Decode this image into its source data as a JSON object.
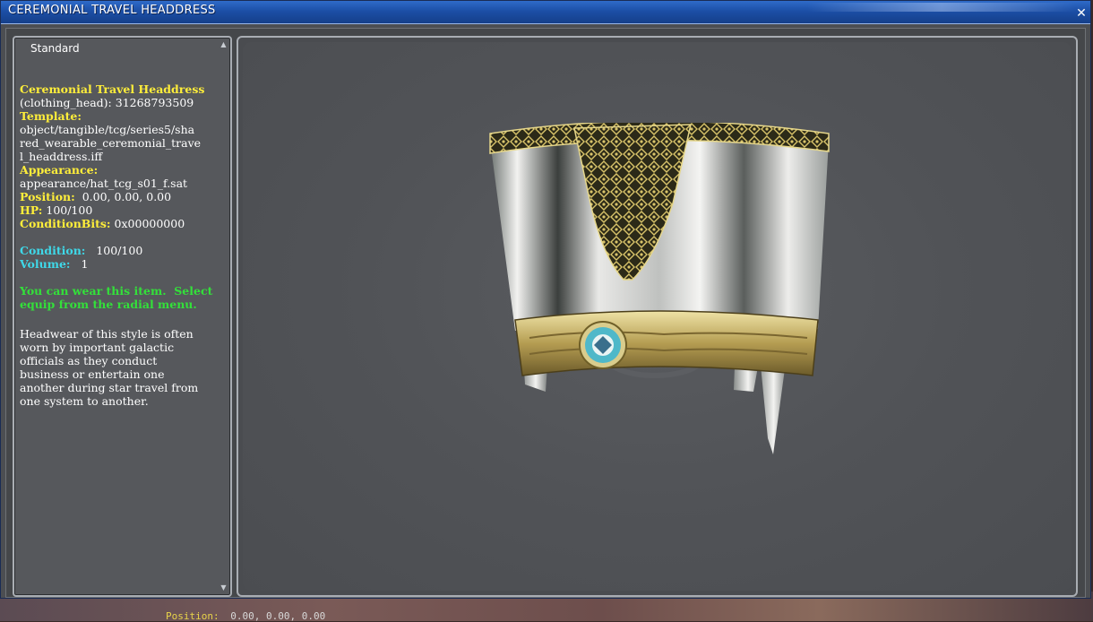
{
  "window": {
    "title": "CEREMONIAL TRAVEL HEADDRESS",
    "close_glyph": "✕"
  },
  "tab": {
    "label": "Standard"
  },
  "item": {
    "name": "Ceremonial Travel Headdress",
    "id_line": "(clothing_head): 31268793509",
    "template_label": "Template:",
    "template_lines": [
      "object/tangible/tcg/series5/sha",
      "red_wearable_ceremonial_trave",
      "l_headdress.iff"
    ],
    "appearance_label": "Appearance:",
    "appearance_value": "appearance/hat_tcg_s01_f.sat",
    "position_label": "Position:",
    "position_value": "  0.00, 0.00, 0.00",
    "hp_label": "HP:",
    "hp_value": " 100/100",
    "conditionbits_label": "ConditionBits:",
    "conditionbits_value": " 0x00000000",
    "condition_label": "Condition:",
    "condition_value": "   100/100",
    "volume_label": "Volume:",
    "volume_value": "   1",
    "wear_lines": [
      "You can wear this item.  Select",
      "equip from the radial menu."
    ],
    "description_lines": [
      "Headwear of this style is often",
      "worn by important galactic",
      "officials as they conduct",
      "business or entertain one",
      "another during star travel from",
      "one system to another."
    ]
  },
  "world": {
    "position_label": "Position:",
    "position_value": "0.00, 0.00, 0.00"
  },
  "colors": {
    "label_yellow": "#ffee3a",
    "label_cyan": "#3fd8e8",
    "wear_green": "#33e03a",
    "titlebar_blue": "#1c4fa6"
  },
  "icons": {
    "close": "close-icon",
    "scroll_up": "scroll-up-icon",
    "scroll_down": "scroll-down-icon"
  }
}
